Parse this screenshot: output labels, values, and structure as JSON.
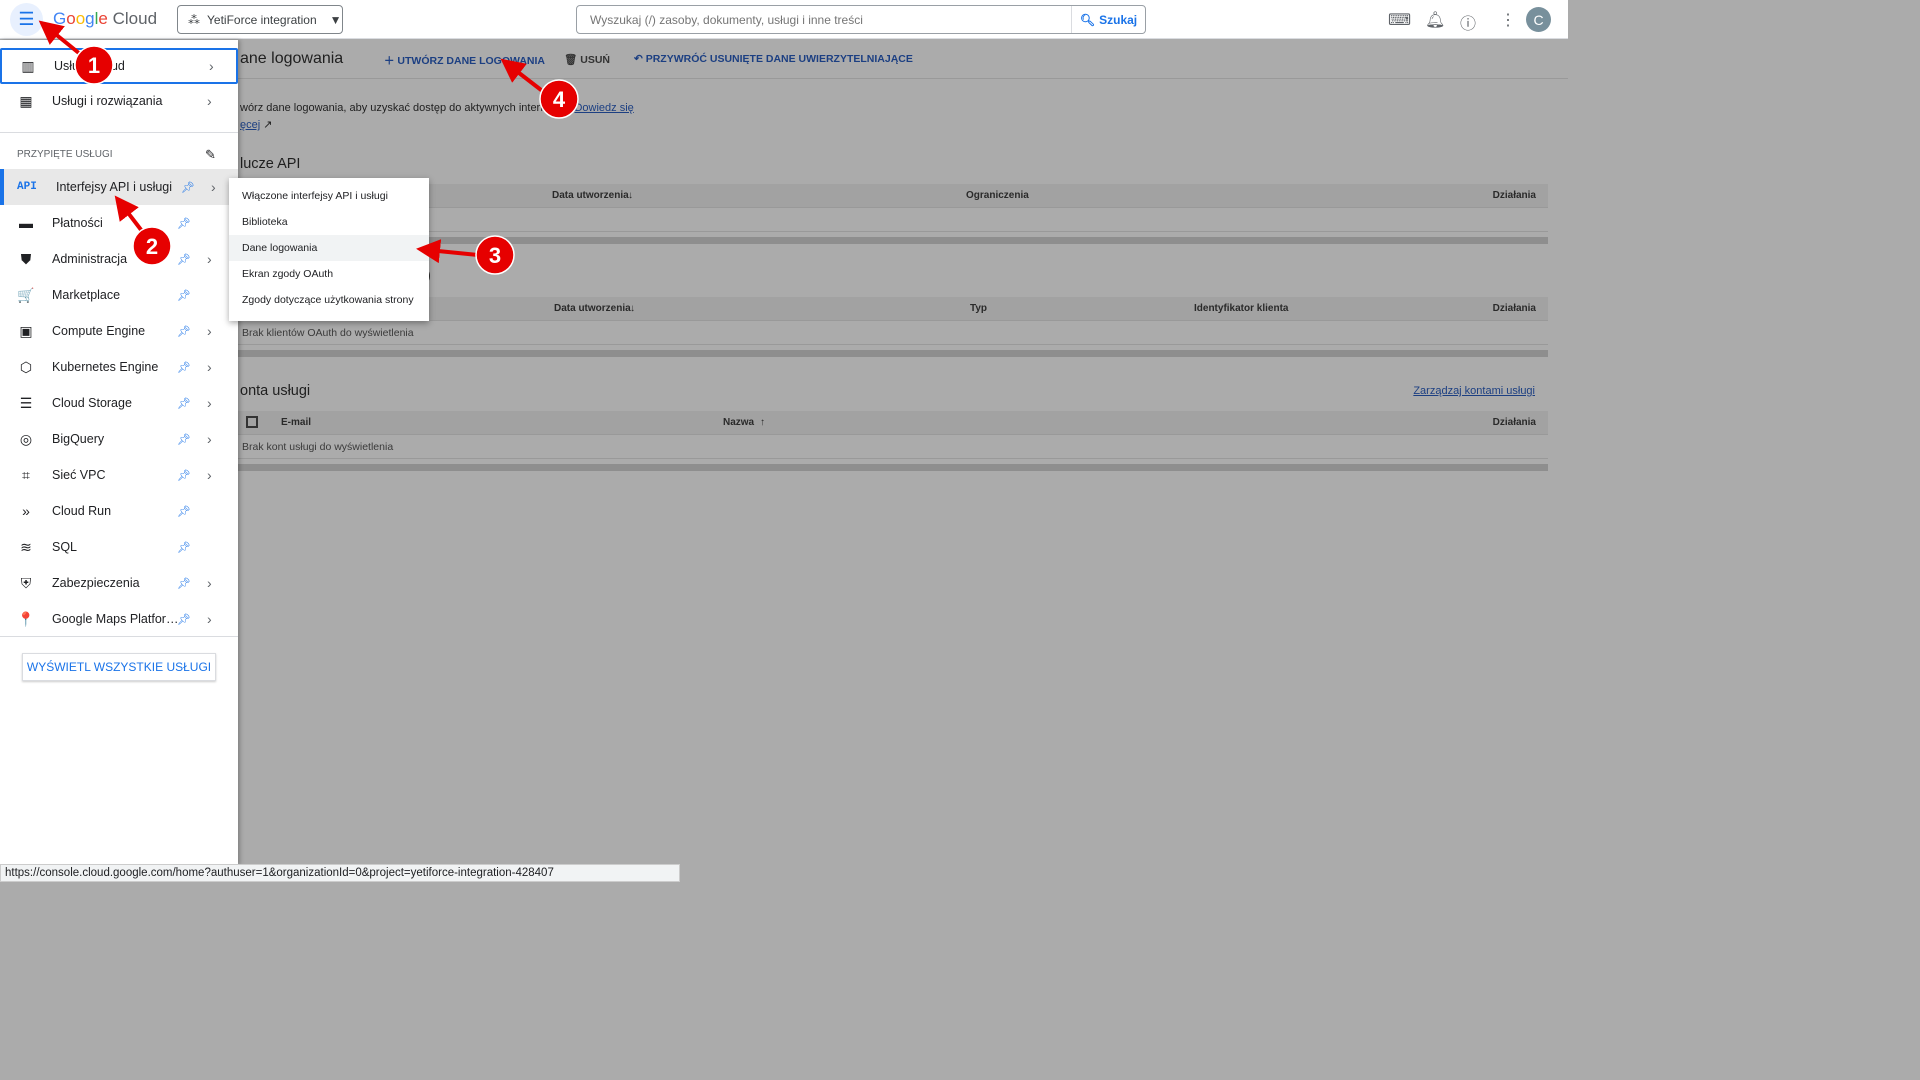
{
  "topbar": {
    "logo": "Google Cloud",
    "logo_colors": [
      "#4285f4",
      "#ea4335",
      "#fbbc05",
      "#4285f4",
      "#34a853",
      "#ea4335"
    ],
    "project": "YetiForce integration",
    "search_placeholder": "Wyszukaj (/) zasoby, dokumenty, usługi i inne treści",
    "search_button": "Szukaj",
    "avatar": "C"
  },
  "sidebar": {
    "top_items": [
      {
        "label": "Usługi Cloud",
        "icon": "dashboard-icon"
      },
      {
        "label": "Usługi i rozwiązania",
        "icon": "grid-icon"
      }
    ],
    "pinned_header": "PRZYPIĘTE USŁUGI",
    "pinned": [
      {
        "label": "Interfejsy API i usługi",
        "icon": "API",
        "chev": true
      },
      {
        "label": "Płatności",
        "icon": "▬",
        "chev": false
      },
      {
        "label": "Administracja",
        "icon": "⛊",
        "chev": true
      },
      {
        "label": "Marketplace",
        "icon": "🛒",
        "chev": false
      },
      {
        "label": "Compute Engine",
        "icon": "▣",
        "chev": true
      },
      {
        "label": "Kubernetes Engine",
        "icon": "⬡",
        "chev": true
      },
      {
        "label": "Cloud Storage",
        "icon": "☰",
        "chev": true
      },
      {
        "label": "BigQuery",
        "icon": "◎",
        "chev": true
      },
      {
        "label": "Sieć VPC",
        "icon": "⌗",
        "chev": true
      },
      {
        "label": "Cloud Run",
        "icon": "»",
        "chev": false
      },
      {
        "label": "SQL",
        "icon": "≋",
        "chev": false
      },
      {
        "label": "Zabezpieczenia",
        "icon": "⛨",
        "chev": true
      },
      {
        "label": "Google Maps Platfor…",
        "icon": "📍",
        "chev": true
      }
    ],
    "all_button": "WYŚWIETL WSZYSTKIE USŁUGI"
  },
  "submenu": [
    "Włączone interfejsy API i usługi",
    "Biblioteka",
    "Dane logowania",
    "Ekran zgody OAuth",
    "Zgody dotyczące użytkowania strony"
  ],
  "main": {
    "title": "ane logowania",
    "create": "UTWÓRZ DANE LOGOWANIA",
    "delete": "USUŃ",
    "restore": "PRZYWRÓĆ USUNIĘTE DANE UWIERZYTELNIAJĄCE",
    "desc1": "wórz dane logowania, aby uzyskać dostęp do aktywnych interfejsów",
    "desc_link": "Dowiedz się",
    "desc2": "ęcej",
    "api_keys": {
      "title": "lucze API",
      "cols": [
        "Data utworzenia",
        "Ograniczenia",
        "Działania"
      ]
    },
    "oauth": {
      "title": ")",
      "cols": [
        "Data utworzenia",
        "Typ",
        "Identyfikator klienta",
        "Działania"
      ],
      "empty": "Brak klientów OAuth do wyświetlenia"
    },
    "sa": {
      "title": "onta usługi",
      "manage": "Zarządzaj kontami usługi",
      "cols": [
        "E-mail",
        "Nazwa",
        "Działania"
      ],
      "empty": "Brak kont usługi do wyświetlenia"
    }
  },
  "annotations": [
    "1",
    "2",
    "3",
    "4"
  ],
  "status_url": "https://console.cloud.google.com/home?authuser=1&organizationId=0&project=yetiforce-integration-428407"
}
